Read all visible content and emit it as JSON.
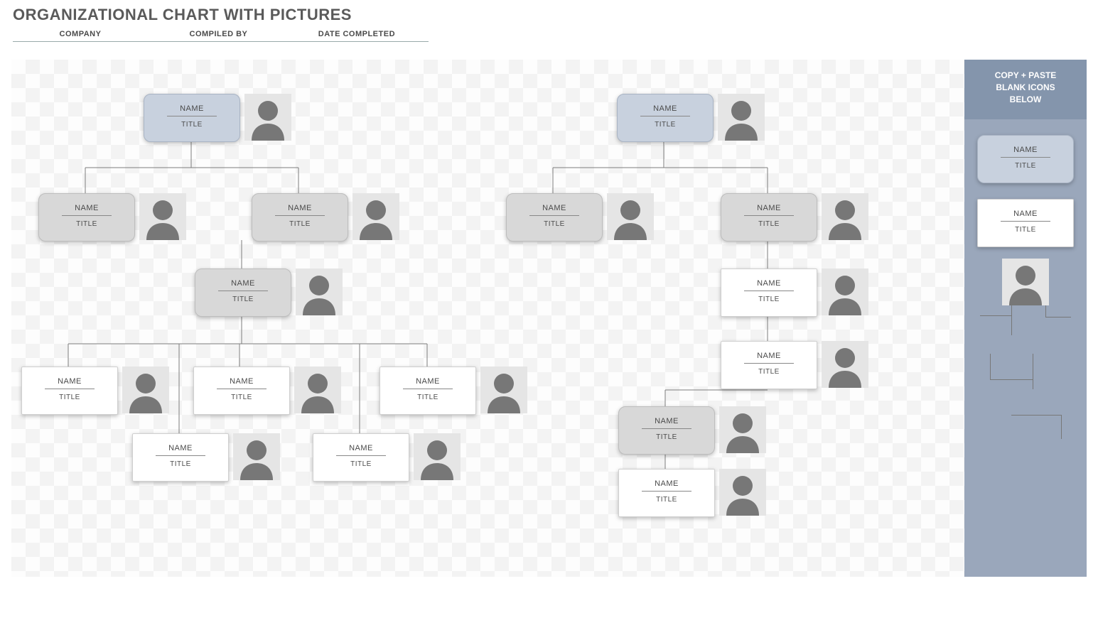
{
  "header": {
    "title": "ORGANIZATIONAL CHART WITH PICTURES"
  },
  "meta": {
    "company_label": "COMPANY",
    "compiled_label": "COMPILED BY",
    "date_label": "DATE COMPLETED"
  },
  "card": {
    "name": "NAME",
    "title": "TITLE"
  },
  "sidebar": {
    "l1": "COPY + PASTE",
    "l2": "BLANK ICONS",
    "l3": "BELOW"
  }
}
